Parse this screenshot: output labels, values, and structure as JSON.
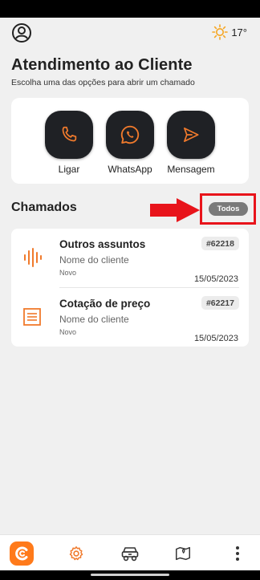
{
  "weather": {
    "icon": "sun-icon",
    "temperature": "17°"
  },
  "header": {
    "title": "Atendimento ao Cliente",
    "subtitle": "Escolha uma das opções para abrir um chamado"
  },
  "actions": [
    {
      "label": "Ligar",
      "icon": "phone-icon"
    },
    {
      "label": "WhatsApp",
      "icon": "whatsapp-icon"
    },
    {
      "label": "Mensagem",
      "icon": "send-icon"
    }
  ],
  "tickets_section": {
    "title": "Chamados",
    "filter_label": "Todos"
  },
  "tickets": [
    {
      "title": "Outros assuntos",
      "client": "Nome do cliente",
      "status": "Novo",
      "id": "#62218",
      "date": "15/05/2023",
      "icon": "audio-wave-icon"
    },
    {
      "title": "Cotação de preço",
      "client": "Nome do cliente",
      "status": "Novo",
      "id": "#62217",
      "date": "15/05/2023",
      "icon": "document-icon"
    }
  ],
  "bottom_nav": [
    {
      "icon": "brand-logo-icon"
    },
    {
      "icon": "gear-icon"
    },
    {
      "icon": "vehicle-icon"
    },
    {
      "icon": "map-pin-icon"
    },
    {
      "icon": "more-vertical-icon"
    }
  ],
  "colors": {
    "accent": "#f07a2c",
    "tile": "#1f2125",
    "highlight": "#e8141b",
    "pill": "#7a7a7a"
  }
}
